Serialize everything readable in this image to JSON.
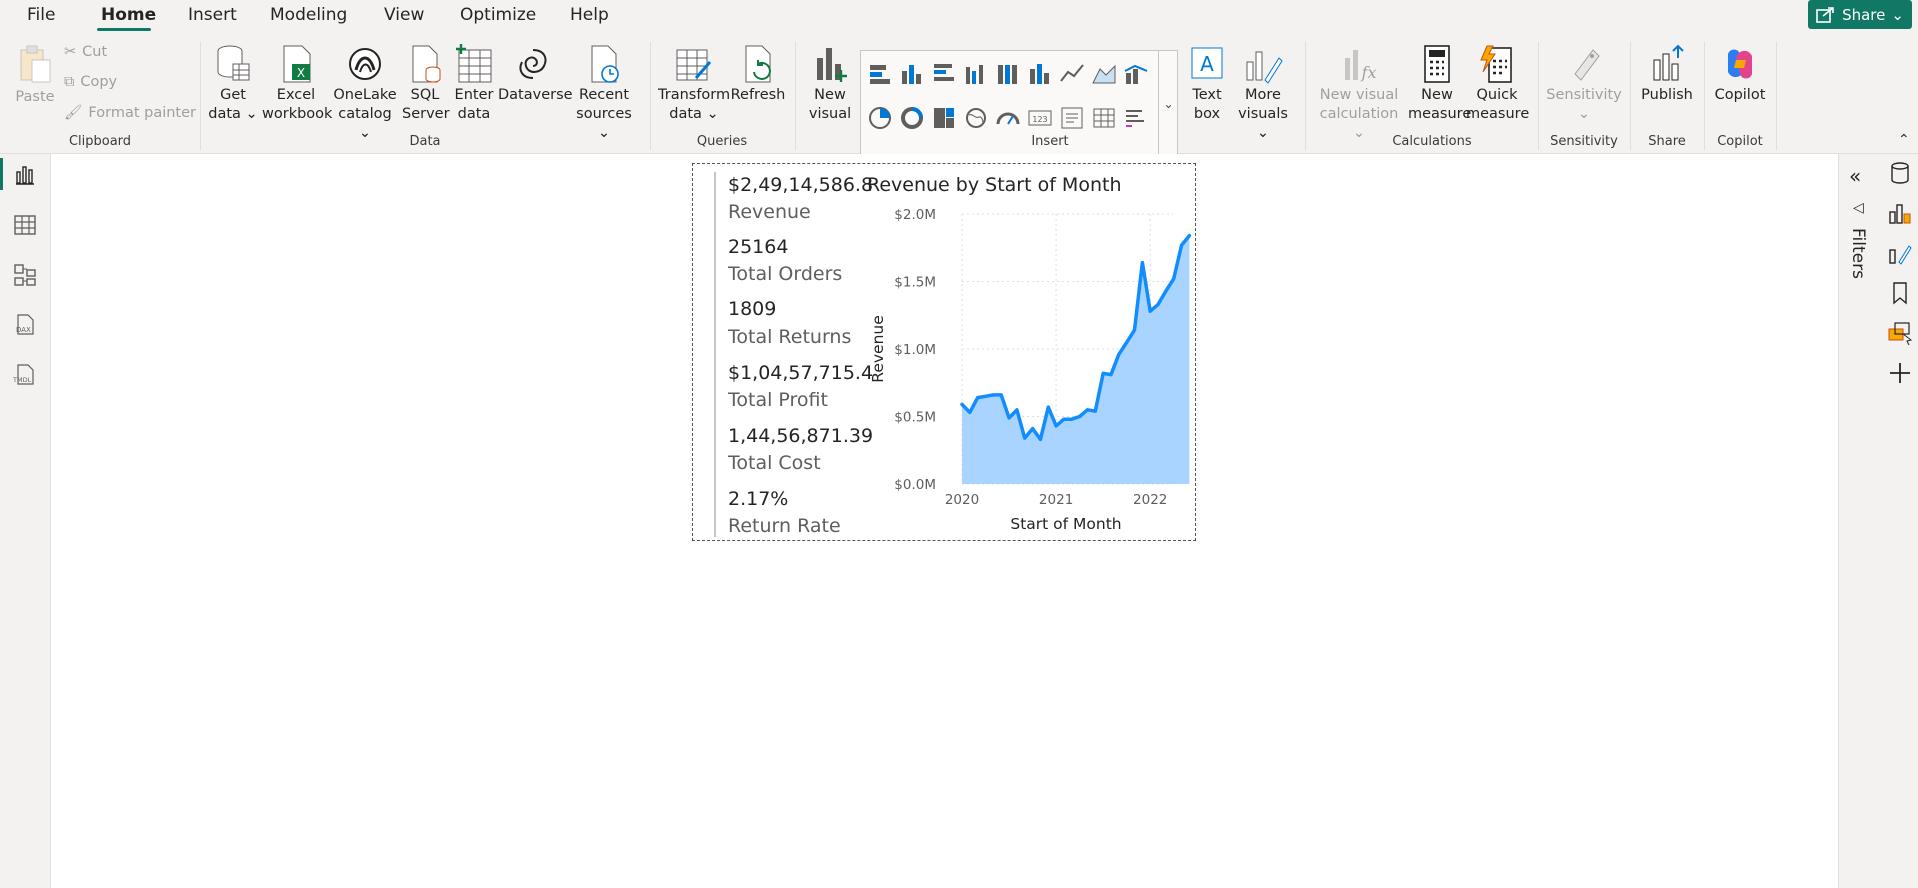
{
  "menu": {
    "file": "File",
    "home": "Home",
    "insert": "Insert",
    "modeling": "Modeling",
    "view": "View",
    "optimize": "Optimize",
    "help": "Help",
    "share": "Share"
  },
  "ribbon": {
    "clipboard": {
      "paste": "Paste",
      "cut": "Cut",
      "copy": "Copy",
      "format_painter": "Format painter",
      "label": "Clipboard"
    },
    "data": {
      "get_data": [
        "Get",
        "data"
      ],
      "excel": [
        "Excel",
        "workbook"
      ],
      "onelake": [
        "OneLake",
        "catalog"
      ],
      "sql": [
        "SQL",
        "Server"
      ],
      "enter": [
        "Enter",
        "data"
      ],
      "dataverse": "Dataverse",
      "recent": [
        "Recent",
        "sources"
      ],
      "label": "Data"
    },
    "queries": {
      "transform": [
        "Transform",
        "data"
      ],
      "refresh": "Refresh",
      "label": "Queries"
    },
    "insert": {
      "new_visual": [
        "New",
        "visual"
      ],
      "text_box": [
        "Text",
        "box"
      ],
      "more_visuals": [
        "More",
        "visuals"
      ],
      "label": "Insert"
    },
    "calculations": {
      "new_visual_calc": [
        "New visual",
        "calculation"
      ],
      "new_measure": [
        "New",
        "measure"
      ],
      "quick_measure": [
        "Quick",
        "measure"
      ],
      "label": "Calculations"
    },
    "sensitivity": {
      "button": "Sensitivity",
      "label": "Sensitivity"
    },
    "share": {
      "publish": "Publish",
      "label": "Share"
    },
    "copilot": {
      "button": "Copilot",
      "label": "Copilot"
    }
  },
  "right_pane": {
    "filters": "Filters"
  },
  "visual": {
    "kpis": [
      {
        "value": "$2,49,14,586.8",
        "label": "Revenue"
      },
      {
        "value": "25164",
        "label": "Total Orders"
      },
      {
        "value": "1809",
        "label": "Total Returns"
      },
      {
        "value": "$1,04,57,715.4",
        "label": "Total Profit"
      },
      {
        "value": "1,44,56,871.39",
        "label": "Total Cost"
      },
      {
        "value": "2.17%",
        "label": "Return Rate"
      }
    ]
  },
  "chart_data": {
    "type": "area",
    "title": "Revenue by Start of Month",
    "xlabel": "Start of Month",
    "ylabel": "Revenue",
    "x_ticks": [
      "2020",
      "2021",
      "2022"
    ],
    "y_ticks": [
      "$0.0M",
      "$0.5M",
      "$1.0M",
      "$1.5M",
      "$2.0M"
    ],
    "ylim": [
      0,
      2.0
    ],
    "y_unit": "$M",
    "grid": true,
    "colors": {
      "line": "#118DFF",
      "fill": "#A9D4FF"
    },
    "series": [
      {
        "x": [
          "2020-01",
          "2020-02",
          "2020-03",
          "2020-04",
          "2020-05",
          "2020-06",
          "2020-07",
          "2020-08",
          "2020-09",
          "2020-10",
          "2020-11",
          "2020-12",
          "2021-01",
          "2021-02",
          "2021-03",
          "2021-04",
          "2021-05",
          "2021-06",
          "2021-07",
          "2021-08",
          "2021-09",
          "2021-10",
          "2021-11",
          "2021-12",
          "2022-01",
          "2022-02",
          "2022-03",
          "2022-04",
          "2022-05",
          "2022-06"
        ],
        "values": [
          0.59,
          0.53,
          0.64,
          0.65,
          0.66,
          0.66,
          0.49,
          0.55,
          0.34,
          0.41,
          0.33,
          0.57,
          0.43,
          0.48,
          0.48,
          0.5,
          0.55,
          0.54,
          0.82,
          0.81,
          0.96,
          1.05,
          1.14,
          1.64,
          1.28,
          1.33,
          1.43,
          1.52,
          1.77,
          1.84
        ]
      }
    ]
  }
}
